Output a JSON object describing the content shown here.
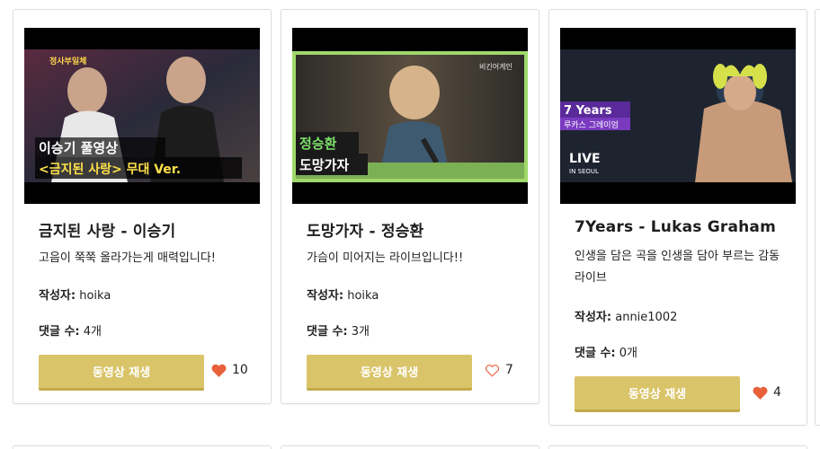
{
  "cards": [
    {
      "title": "금지된 사랑 - 이승기",
      "description": "고음이 쭉쭉 올라가는게 매력입니다!",
      "author_label": "작성자:",
      "author": "hoika",
      "comments_label": "댓글 수:",
      "comments": "4개",
      "play_label": "동영상 재생",
      "likes": "10",
      "liked": true,
      "thumb": {
        "badge": "정사부일체",
        "caption1": "이승기 풀영상",
        "caption2": "<금지된 사랑> 무대 Ver."
      }
    },
    {
      "title": "도망가자 - 정승환",
      "description": "가슴이 미어지는 라이브입니다!!",
      "author_label": "작성자:",
      "author": "hoika",
      "comments_label": "댓글 수:",
      "comments": "3개",
      "play_label": "동영상 재생",
      "likes": "7",
      "liked": false,
      "thumb": {
        "badge": "비긴어게인",
        "caption1": "정승환",
        "caption2": "도망가자"
      }
    },
    {
      "title": "7Years - Lukas Graham",
      "description": "인생을 담은 곡을 인생을 담아 부르는 감동 라이브",
      "author_label": "작성자:",
      "author": "annie1002",
      "comments_label": "댓글 수:",
      "comments": "0개",
      "play_label": "동영상 재생",
      "likes": "4",
      "liked": true,
      "thumb": {
        "caption1": "7 Years",
        "caption2": "루카스 그레이엄",
        "live": "LIVE",
        "live_sub": "IN SEOUL"
      }
    }
  ],
  "colors": {
    "button": "#d9c469",
    "heart_filled": "#e8613a",
    "heart_outline": "#e8613a"
  }
}
